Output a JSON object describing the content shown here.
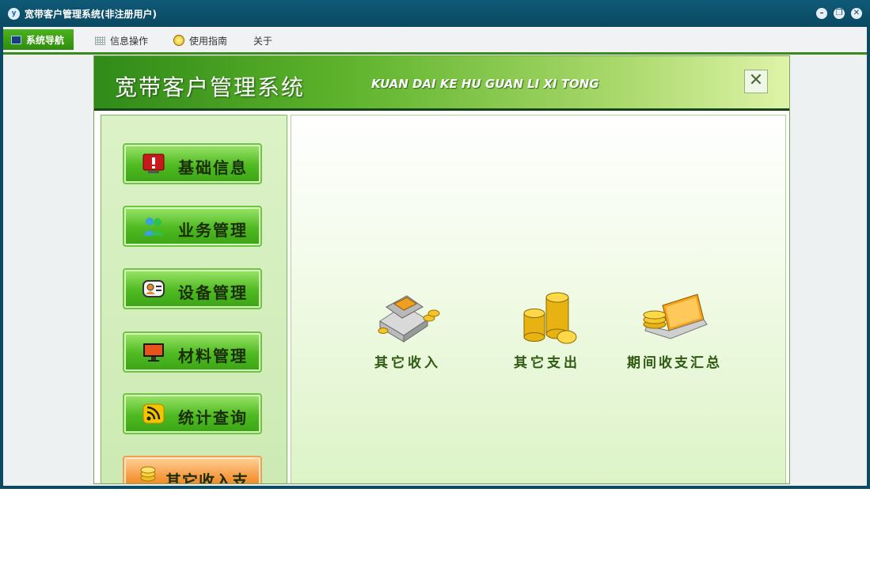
{
  "window": {
    "title": "宽带客户管理系统(非注册用户)",
    "app_icon": "y",
    "controls": [
      "minimize-icon",
      "restore-icon",
      "close-icon"
    ]
  },
  "menubar": {
    "items": [
      {
        "label": "系统导航",
        "icon": "monitor-icon",
        "active": true
      },
      {
        "label": "信息操作",
        "icon": "grid-icon",
        "active": false
      },
      {
        "label": "使用指南",
        "icon": "lightbulb-icon",
        "active": false
      },
      {
        "label": "关于",
        "icon": "",
        "active": false
      }
    ]
  },
  "panel": {
    "title": "宽带客户管理系统",
    "subtitle": "KUAN DAI KE HU GUAN LI XI TONG",
    "close_symbol": "✕"
  },
  "sidebar": {
    "items": [
      {
        "label": "基础信息",
        "icon": "alert-monitor-icon"
      },
      {
        "label": "业务管理",
        "icon": "users-icon"
      },
      {
        "label": "设备管理",
        "icon": "contact-card-icon"
      },
      {
        "label": "材料管理",
        "icon": "monitor-icon"
      },
      {
        "label": "统计查询",
        "icon": "rss-icon"
      },
      {
        "label": "其它收入支出",
        "icon": "coins-icon"
      }
    ]
  },
  "features": [
    {
      "label": "其它收入",
      "icon": "cash-register-icon"
    },
    {
      "label": "其它支出",
      "icon": "coin-stack-icon"
    },
    {
      "label": "期间收支汇总",
      "icon": "laptop-coins-icon"
    }
  ],
  "colors": {
    "titlebar": "#0a4862",
    "accent_green": "#3aa416",
    "accent_orange": "#f49233"
  }
}
